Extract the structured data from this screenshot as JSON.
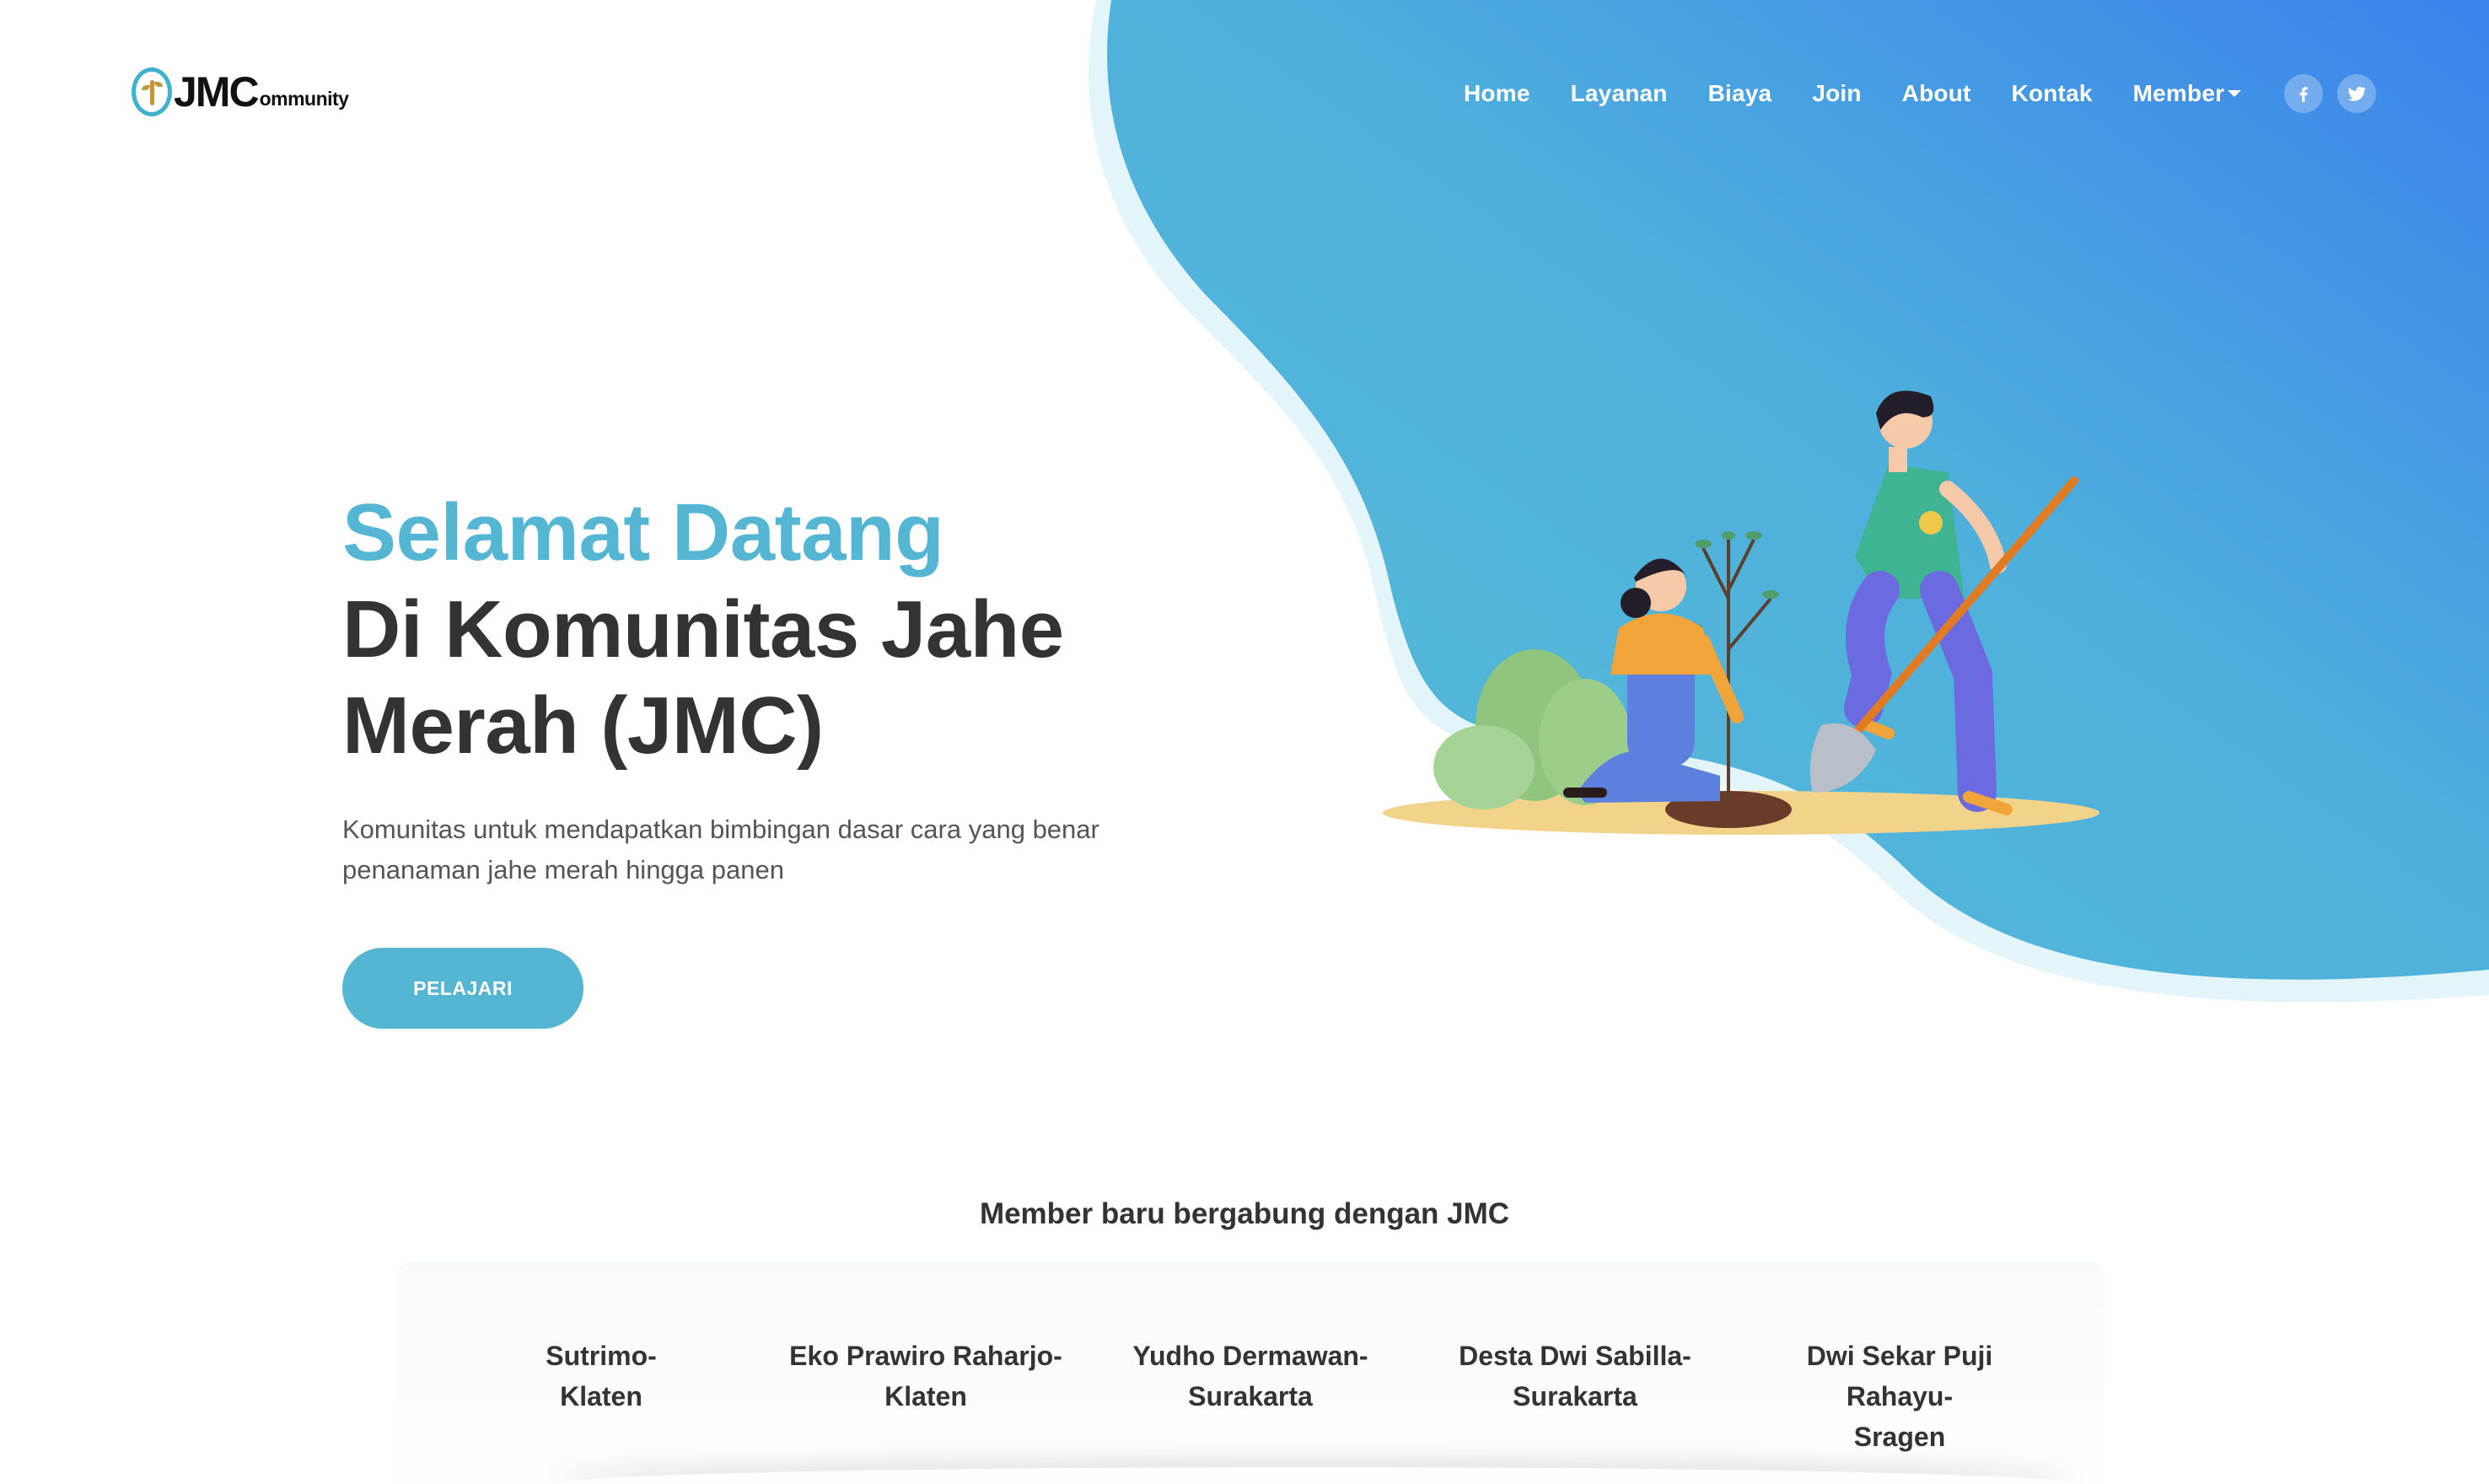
{
  "brand": {
    "logo_main": "JMC",
    "logo_sub": "ommunity"
  },
  "nav": {
    "items": [
      {
        "label": "Home"
      },
      {
        "label": "Layanan"
      },
      {
        "label": "Biaya"
      },
      {
        "label": "Join"
      },
      {
        "label": "About"
      },
      {
        "label": "Kontak"
      },
      {
        "label": "Member"
      }
    ],
    "social": [
      "facebook-icon",
      "twitter-icon"
    ]
  },
  "hero": {
    "title_accent": "Selamat Datang",
    "title_line2": "Di Komunitas Jahe",
    "title_line3": "Merah (JMC)",
    "description": "Komunitas untuk mendapatkan bimbingan dasar cara yang benar penanaman jahe merah hingga panen",
    "cta_label": "PELAJARI"
  },
  "members": {
    "title": "Member baru bergabung dengan JMC",
    "list": [
      {
        "line1": "Sutrimo-",
        "line2": "Klaten",
        "line3": ""
      },
      {
        "line1": "Eko Prawiro Raharjo-",
        "line2": "Klaten",
        "line3": ""
      },
      {
        "line1": "Yudho Dermawan-",
        "line2": "Surakarta",
        "line3": ""
      },
      {
        "line1": "Desta Dwi Sabilla-",
        "line2": "Surakarta",
        "line3": ""
      },
      {
        "line1": "Dwi Sekar Puji",
        "line2": "Rahayu-",
        "line3": "Sragen"
      }
    ]
  },
  "colors": {
    "accent": "#54b6d3",
    "blob_start": "#56bcd5",
    "blob_end": "#3b82ec",
    "heading": "#333333"
  }
}
